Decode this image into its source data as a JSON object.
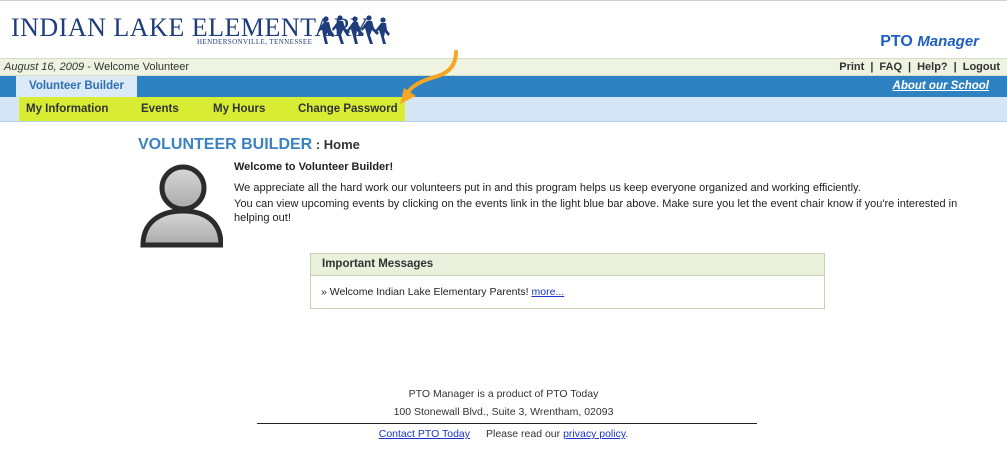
{
  "header": {
    "school_name": "INDIAN LAKE ELEMENTARY",
    "school_location": "HENDERSONVILLE, TENNESSEE",
    "brand_pto": "PTO",
    "brand_manager": "Manager"
  },
  "info_bar": {
    "date": "August 16, 2009",
    "welcome": " - Welcome Volunteer",
    "links": [
      "Print",
      "FAQ",
      "Help?",
      "Logout"
    ]
  },
  "nav": {
    "active_tab": "Volunteer Builder",
    "about_link": "About our School"
  },
  "subnav": {
    "items": [
      "My Information",
      "Events",
      "My Hours",
      "Change Password"
    ],
    "highlight_color": "#d8ec34",
    "arrow_color": "#f5a623"
  },
  "main": {
    "title": "VOLUNTEER BUILDER",
    "title_suffix": " : Home",
    "welcome_heading": "Welcome to Volunteer Builder!",
    "paragraph1": "We appreciate all the hard work our volunteers put in and this program helps us keep everyone organized and working efficiently.",
    "paragraph2": "You can view upcoming events by clicking on the events link in the light blue bar above. Make sure you let the event chair know if you're interested in helping out!"
  },
  "messages": {
    "heading": "Important Messages",
    "item_text": "» Welcome Indian Lake Elementary Parents! ",
    "more_link": "more..."
  },
  "footer": {
    "line1": "PTO Manager is a product of PTO Today",
    "line2": "100 Stonewall Blvd., Suite 3, Wrentham, 02093",
    "contact_link": "Contact PTO Today",
    "privacy_prefix": "Please read our ",
    "privacy_link": "privacy policy",
    "privacy_suffix": "."
  },
  "colors": {
    "nav_blue": "#2f82c1",
    "subnav_blue": "#d4e5f6",
    "title_blue": "#3a82c4",
    "info_bar_green": "#eef3e2"
  }
}
